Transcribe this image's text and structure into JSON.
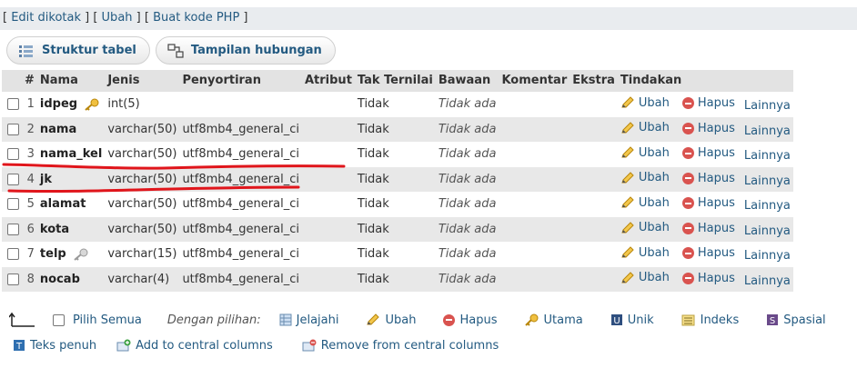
{
  "linkbar": {
    "open": "[ ",
    "edit": "Edit dikotak",
    "sep1": " ] [ ",
    "ubah": "Ubah",
    "sep2": " ] [ ",
    "buat": "Buat kode PHP",
    "close": " ]"
  },
  "tabs": {
    "struktur": "Struktur tabel",
    "hubungan": "Tampilan hubungan"
  },
  "table": {
    "headers": [
      "#",
      "Nama",
      "Jenis",
      "Penyortiran",
      "Atribut",
      "Tak Ternilai",
      "Bawaan",
      "Komentar",
      "Ekstra",
      "Tindakan"
    ],
    "rows": [
      {
        "num": "1",
        "name": "idpeg",
        "type": "int(5)",
        "collation": "",
        "null": "Tidak",
        "default": "Tidak ada",
        "icon": "key-icon"
      },
      {
        "num": "2",
        "name": "nama",
        "type": "varchar(50)",
        "collation": "utf8mb4_general_ci",
        "null": "Tidak",
        "default": "Tidak ada",
        "icon": ""
      },
      {
        "num": "3",
        "name": "nama_kel",
        "type": "varchar(50)",
        "collation": "utf8mb4_general_ci",
        "null": "Tidak",
        "default": "Tidak ada",
        "icon": ""
      },
      {
        "num": "4",
        "name": "jk",
        "type": "varchar(50)",
        "collation": "utf8mb4_general_ci",
        "null": "Tidak",
        "default": "Tidak ada",
        "icon": ""
      },
      {
        "num": "5",
        "name": "alamat",
        "type": "varchar(50)",
        "collation": "utf8mb4_general_ci",
        "null": "Tidak",
        "default": "Tidak ada",
        "icon": ""
      },
      {
        "num": "6",
        "name": "kota",
        "type": "varchar(50)",
        "collation": "utf8mb4_general_ci",
        "null": "Tidak",
        "default": "Tidak ada",
        "icon": ""
      },
      {
        "num": "7",
        "name": "telp",
        "type": "varchar(15)",
        "collation": "utf8mb4_general_ci",
        "null": "Tidak",
        "default": "Tidak ada",
        "icon": "index-key-icon"
      },
      {
        "num": "8",
        "name": "nocab",
        "type": "varchar(4)",
        "collation": "utf8mb4_general_ci",
        "null": "Tidak",
        "default": "Tidak ada",
        "icon": ""
      }
    ],
    "actions": {
      "ubah": "Ubah",
      "hapus": "Hapus",
      "lainnya": "Lainnya"
    }
  },
  "bulk": {
    "pilih_semua": "Pilih Semua",
    "dengan_pilihan": "Dengan pilihan:",
    "jelajahi": "Jelajahi",
    "ubah": "Ubah",
    "hapus": "Hapus",
    "utama": "Utama",
    "unik": "Unik",
    "indeks": "Indeks",
    "spasial": "Spasial",
    "teks_penuh": "Teks penuh",
    "add_central": "Add to central columns",
    "remove_central": "Remove from central columns"
  },
  "colors": {
    "link": "#235a81",
    "header_bg": "#e3e3e3",
    "row_even": "#e8e8e8",
    "annotation": "#e0151b"
  }
}
